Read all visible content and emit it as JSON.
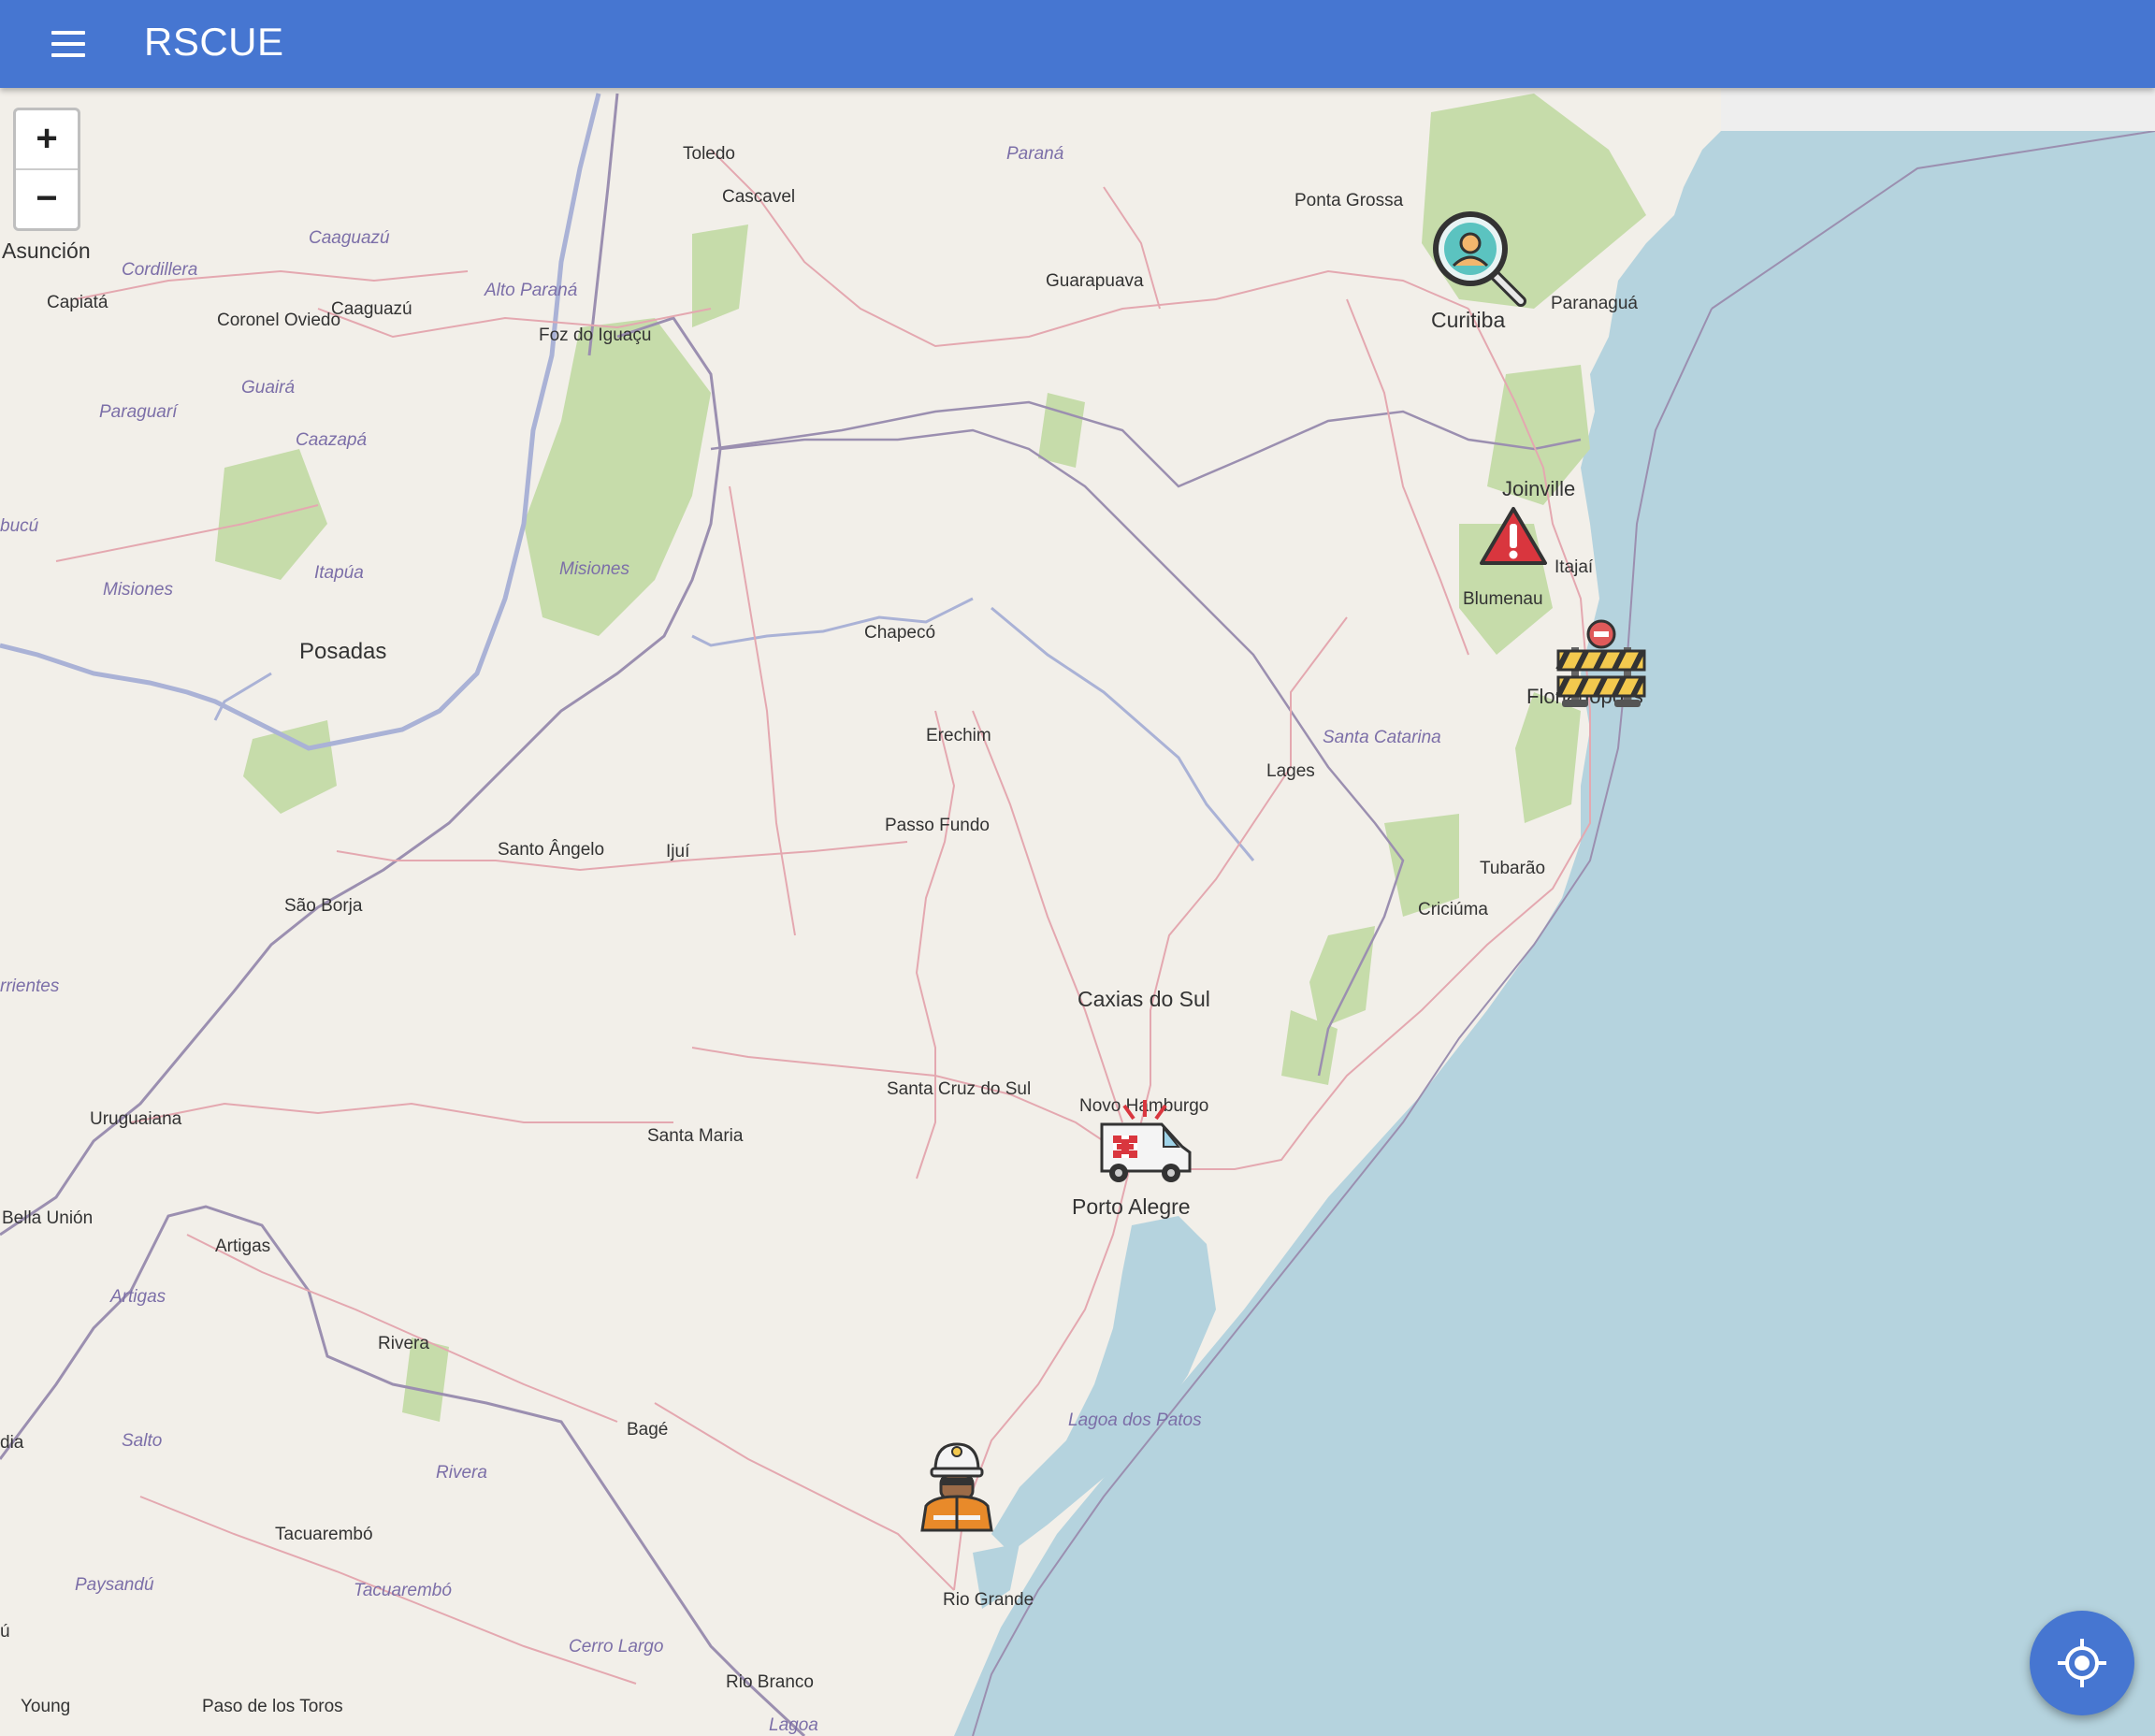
{
  "app": {
    "title": "RSCUE"
  },
  "zoom": {
    "in_label": "+",
    "out_label": "−"
  },
  "colors": {
    "appbar": "#4676d1",
    "land": "#f2efe9",
    "sea": "#b5d3de",
    "forest": "#c6dcaa"
  },
  "map": {
    "places": [
      {
        "name": "Toledo"
      },
      {
        "name": "Cascavel"
      },
      {
        "name": "Paraná"
      },
      {
        "name": "Ponta Grossa"
      },
      {
        "name": "Curitiba"
      },
      {
        "name": "Paranaguá"
      },
      {
        "name": "Guarapuava"
      },
      {
        "name": "Asunción"
      },
      {
        "name": "Capiatá"
      },
      {
        "name": "Cordillera"
      },
      {
        "name": "Caaguazú"
      },
      {
        "name": "Caaguazú"
      },
      {
        "name": "Coronel Oviedo"
      },
      {
        "name": "Alto Paraná"
      },
      {
        "name": "Foz do Iguaçu"
      },
      {
        "name": "Guairá"
      },
      {
        "name": "Paraguarí"
      },
      {
        "name": "Caazapá"
      },
      {
        "name": "Itapúa"
      },
      {
        "name": "Misiones"
      },
      {
        "name": "Misiones"
      },
      {
        "name": "Posadas"
      },
      {
        "name": "Joinville"
      },
      {
        "name": "Itajaí"
      },
      {
        "name": "Blumenau"
      },
      {
        "name": "Chapecó"
      },
      {
        "name": "Florianópolis"
      },
      {
        "name": "Erechim"
      },
      {
        "name": "Santa Catarina"
      },
      {
        "name": "Lages"
      },
      {
        "name": "Passo Fundo"
      },
      {
        "name": "Santo Ângelo"
      },
      {
        "name": "Ijuí"
      },
      {
        "name": "São Borja"
      },
      {
        "name": "Tubarão"
      },
      {
        "name": "Criciúma"
      },
      {
        "name": "rrientes"
      },
      {
        "name": "Caxias do Sul"
      },
      {
        "name": "Uruguaiana"
      },
      {
        "name": "Santa Cruz do Sul"
      },
      {
        "name": "Novo Hamburgo"
      },
      {
        "name": "Santa Maria"
      },
      {
        "name": "Porto Alegre"
      },
      {
        "name": "Bella Unión"
      },
      {
        "name": "Artigas"
      },
      {
        "name": "Artigas"
      },
      {
        "name": "Rivera"
      },
      {
        "name": "Lagoa dos Patos"
      },
      {
        "name": "Bagé"
      },
      {
        "name": "dia"
      },
      {
        "name": "Salto"
      },
      {
        "name": "Rivera"
      },
      {
        "name": "Tacuarembó"
      },
      {
        "name": "Paysandú"
      },
      {
        "name": "Tacuarembó"
      },
      {
        "name": "Rio Grande"
      },
      {
        "name": "Cerro Largo"
      },
      {
        "name": "Rio Branco"
      },
      {
        "name": "Young"
      },
      {
        "name": "Paso de los Toros"
      },
      {
        "name": "Lagoa"
      },
      {
        "name": "bucú"
      },
      {
        "name": "ú"
      }
    ]
  },
  "markers": [
    {
      "type": "missing-person",
      "icon": "missing-person-search-icon"
    },
    {
      "type": "hazard-warning",
      "icon": "warning-triangle-icon"
    },
    {
      "type": "road-block",
      "icon": "road-barrier-icon"
    },
    {
      "type": "ambulance",
      "icon": "ambulance-icon"
    },
    {
      "type": "rescuer",
      "icon": "rescue-worker-icon"
    }
  ],
  "controls": {
    "locate": "my-location-icon",
    "menu": "menu-icon"
  }
}
